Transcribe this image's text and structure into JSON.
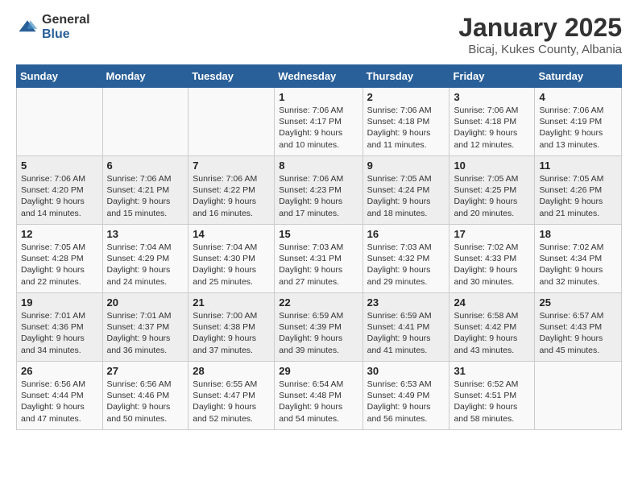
{
  "logo": {
    "general": "General",
    "blue": "Blue"
  },
  "title": "January 2025",
  "subtitle": "Bicaj, Kukes County, Albania",
  "days_of_week": [
    "Sunday",
    "Monday",
    "Tuesday",
    "Wednesday",
    "Thursday",
    "Friday",
    "Saturday"
  ],
  "weeks": [
    [
      {
        "day": "",
        "info": ""
      },
      {
        "day": "",
        "info": ""
      },
      {
        "day": "",
        "info": ""
      },
      {
        "day": "1",
        "info": "Sunrise: 7:06 AM\nSunset: 4:17 PM\nDaylight: 9 hours\nand 10 minutes."
      },
      {
        "day": "2",
        "info": "Sunrise: 7:06 AM\nSunset: 4:18 PM\nDaylight: 9 hours\nand 11 minutes."
      },
      {
        "day": "3",
        "info": "Sunrise: 7:06 AM\nSunset: 4:18 PM\nDaylight: 9 hours\nand 12 minutes."
      },
      {
        "day": "4",
        "info": "Sunrise: 7:06 AM\nSunset: 4:19 PM\nDaylight: 9 hours\nand 13 minutes."
      }
    ],
    [
      {
        "day": "5",
        "info": "Sunrise: 7:06 AM\nSunset: 4:20 PM\nDaylight: 9 hours\nand 14 minutes."
      },
      {
        "day": "6",
        "info": "Sunrise: 7:06 AM\nSunset: 4:21 PM\nDaylight: 9 hours\nand 15 minutes."
      },
      {
        "day": "7",
        "info": "Sunrise: 7:06 AM\nSunset: 4:22 PM\nDaylight: 9 hours\nand 16 minutes."
      },
      {
        "day": "8",
        "info": "Sunrise: 7:06 AM\nSunset: 4:23 PM\nDaylight: 9 hours\nand 17 minutes."
      },
      {
        "day": "9",
        "info": "Sunrise: 7:05 AM\nSunset: 4:24 PM\nDaylight: 9 hours\nand 18 minutes."
      },
      {
        "day": "10",
        "info": "Sunrise: 7:05 AM\nSunset: 4:25 PM\nDaylight: 9 hours\nand 20 minutes."
      },
      {
        "day": "11",
        "info": "Sunrise: 7:05 AM\nSunset: 4:26 PM\nDaylight: 9 hours\nand 21 minutes."
      }
    ],
    [
      {
        "day": "12",
        "info": "Sunrise: 7:05 AM\nSunset: 4:28 PM\nDaylight: 9 hours\nand 22 minutes."
      },
      {
        "day": "13",
        "info": "Sunrise: 7:04 AM\nSunset: 4:29 PM\nDaylight: 9 hours\nand 24 minutes."
      },
      {
        "day": "14",
        "info": "Sunrise: 7:04 AM\nSunset: 4:30 PM\nDaylight: 9 hours\nand 25 minutes."
      },
      {
        "day": "15",
        "info": "Sunrise: 7:03 AM\nSunset: 4:31 PM\nDaylight: 9 hours\nand 27 minutes."
      },
      {
        "day": "16",
        "info": "Sunrise: 7:03 AM\nSunset: 4:32 PM\nDaylight: 9 hours\nand 29 minutes."
      },
      {
        "day": "17",
        "info": "Sunrise: 7:02 AM\nSunset: 4:33 PM\nDaylight: 9 hours\nand 30 minutes."
      },
      {
        "day": "18",
        "info": "Sunrise: 7:02 AM\nSunset: 4:34 PM\nDaylight: 9 hours\nand 32 minutes."
      }
    ],
    [
      {
        "day": "19",
        "info": "Sunrise: 7:01 AM\nSunset: 4:36 PM\nDaylight: 9 hours\nand 34 minutes."
      },
      {
        "day": "20",
        "info": "Sunrise: 7:01 AM\nSunset: 4:37 PM\nDaylight: 9 hours\nand 36 minutes."
      },
      {
        "day": "21",
        "info": "Sunrise: 7:00 AM\nSunset: 4:38 PM\nDaylight: 9 hours\nand 37 minutes."
      },
      {
        "day": "22",
        "info": "Sunrise: 6:59 AM\nSunset: 4:39 PM\nDaylight: 9 hours\nand 39 minutes."
      },
      {
        "day": "23",
        "info": "Sunrise: 6:59 AM\nSunset: 4:41 PM\nDaylight: 9 hours\nand 41 minutes."
      },
      {
        "day": "24",
        "info": "Sunrise: 6:58 AM\nSunset: 4:42 PM\nDaylight: 9 hours\nand 43 minutes."
      },
      {
        "day": "25",
        "info": "Sunrise: 6:57 AM\nSunset: 4:43 PM\nDaylight: 9 hours\nand 45 minutes."
      }
    ],
    [
      {
        "day": "26",
        "info": "Sunrise: 6:56 AM\nSunset: 4:44 PM\nDaylight: 9 hours\nand 47 minutes."
      },
      {
        "day": "27",
        "info": "Sunrise: 6:56 AM\nSunset: 4:46 PM\nDaylight: 9 hours\nand 50 minutes."
      },
      {
        "day": "28",
        "info": "Sunrise: 6:55 AM\nSunset: 4:47 PM\nDaylight: 9 hours\nand 52 minutes."
      },
      {
        "day": "29",
        "info": "Sunrise: 6:54 AM\nSunset: 4:48 PM\nDaylight: 9 hours\nand 54 minutes."
      },
      {
        "day": "30",
        "info": "Sunrise: 6:53 AM\nSunset: 4:49 PM\nDaylight: 9 hours\nand 56 minutes."
      },
      {
        "day": "31",
        "info": "Sunrise: 6:52 AM\nSunset: 4:51 PM\nDaylight: 9 hours\nand 58 minutes."
      },
      {
        "day": "",
        "info": ""
      }
    ]
  ]
}
